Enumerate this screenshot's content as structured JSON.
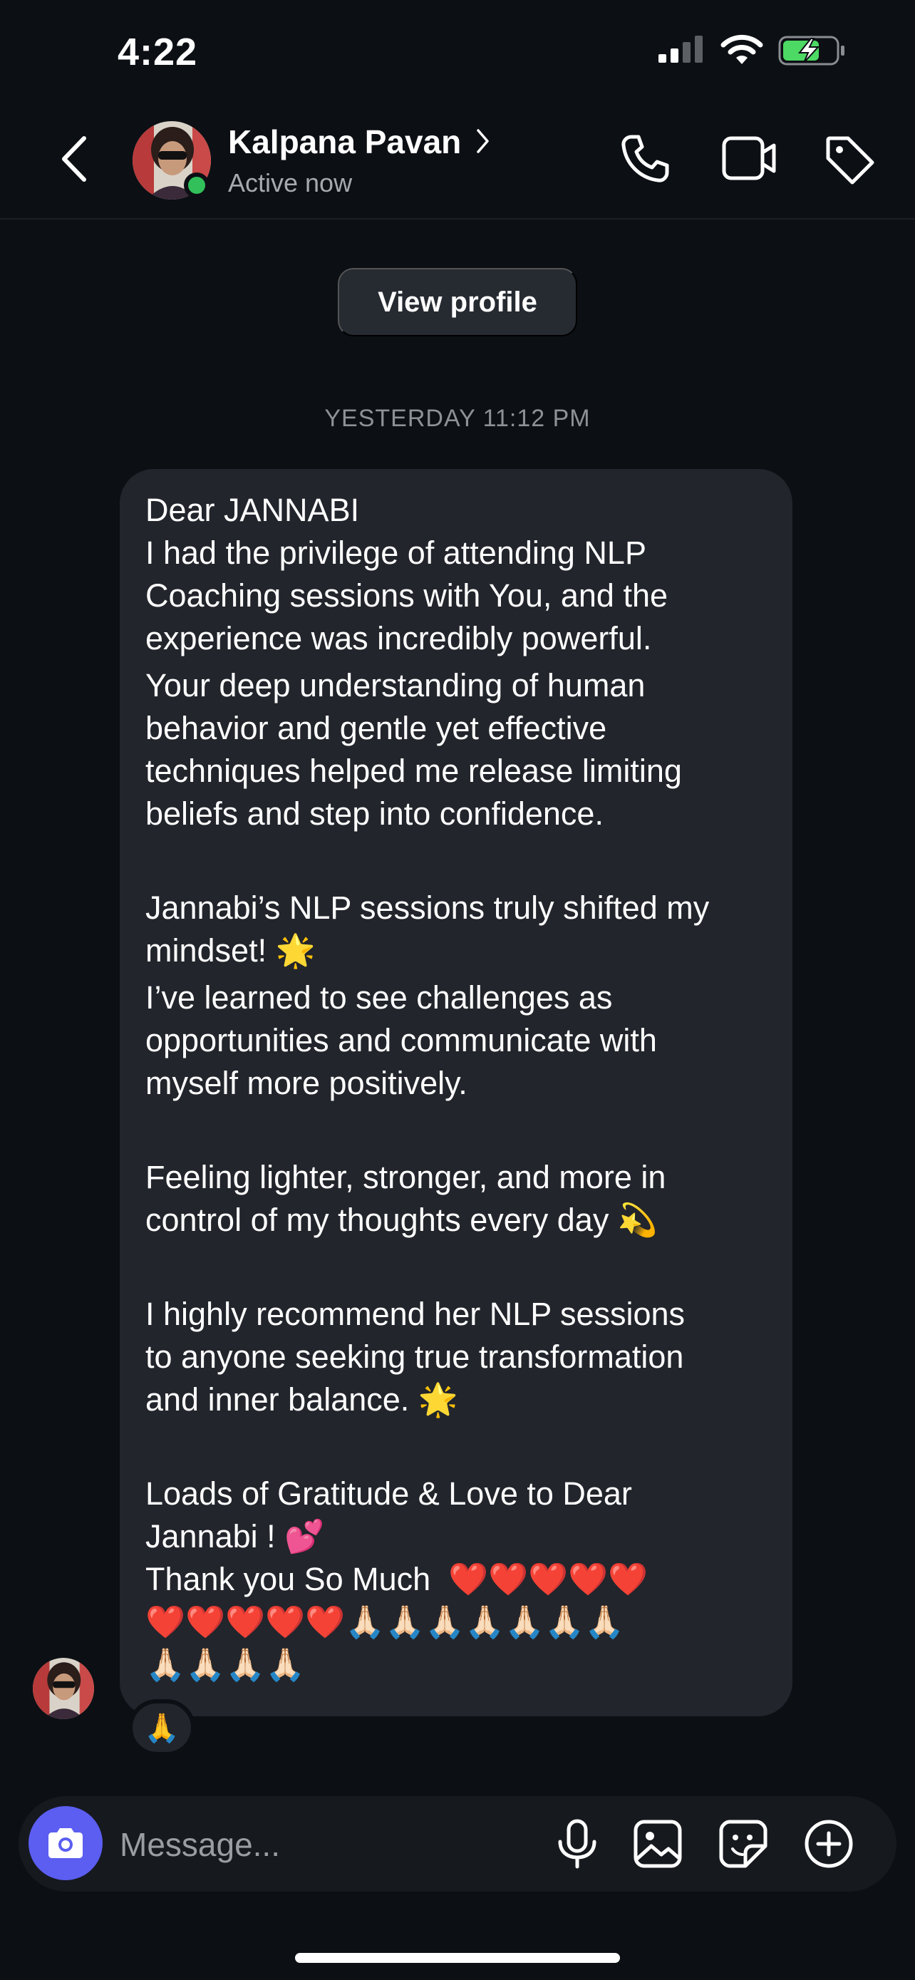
{
  "status_bar": {
    "time": "4:22"
  },
  "header": {
    "contact_name": "Kalpana Pavan",
    "status": "Active now"
  },
  "view_profile_label": "View profile",
  "timestamp": "YESTERDAY 11:12 PM",
  "message": {
    "paragraphs": [
      "Dear JANNABI\nI had the privilege of attending NLP\nCoaching sessions with You, and the\nexperience was incredibly powerful.",
      "Your deep understanding of human\nbehavior and gentle yet effective\ntechniques helped me release limiting\nbeliefs and step into confidence.",
      "Jannabi’s NLP sessions truly shifted my\nmindset! 🌟",
      "I’ve learned to see challenges as\nopportunities and communicate with\nmyself more positively.",
      "Feeling lighter, stronger, and more in\ncontrol of my thoughts every day 💫",
      "I highly recommend her NLP sessions\nto anyone seeking true transformation\nand inner balance. 🌟",
      "Loads of Gratitude & Love to Dear\nJannabi ! 💕\nThank you So Much  ❤️❤️❤️❤️❤️\n❤️❤️❤️❤️❤️🙏🏻🙏🏻🙏🏻🙏🏻🙏🏻🙏🏻🙏🏻\n🙏🏻🙏🏻🙏🏻🙏🏻"
    ],
    "reaction": "🙏"
  },
  "composer": {
    "placeholder": "Message..."
  },
  "colors": {
    "background": "#0c0f14",
    "bubble": "#22252b",
    "accent_camera": "#5b5ef0",
    "online": "#31c05a",
    "battery_charge": "#4cd964"
  },
  "icons": [
    "back-icon",
    "chevron-right-icon",
    "phone-icon",
    "video-icon",
    "tag-icon",
    "camera-icon",
    "microphone-icon",
    "gallery-icon",
    "sticker-icon",
    "plus-icon"
  ]
}
